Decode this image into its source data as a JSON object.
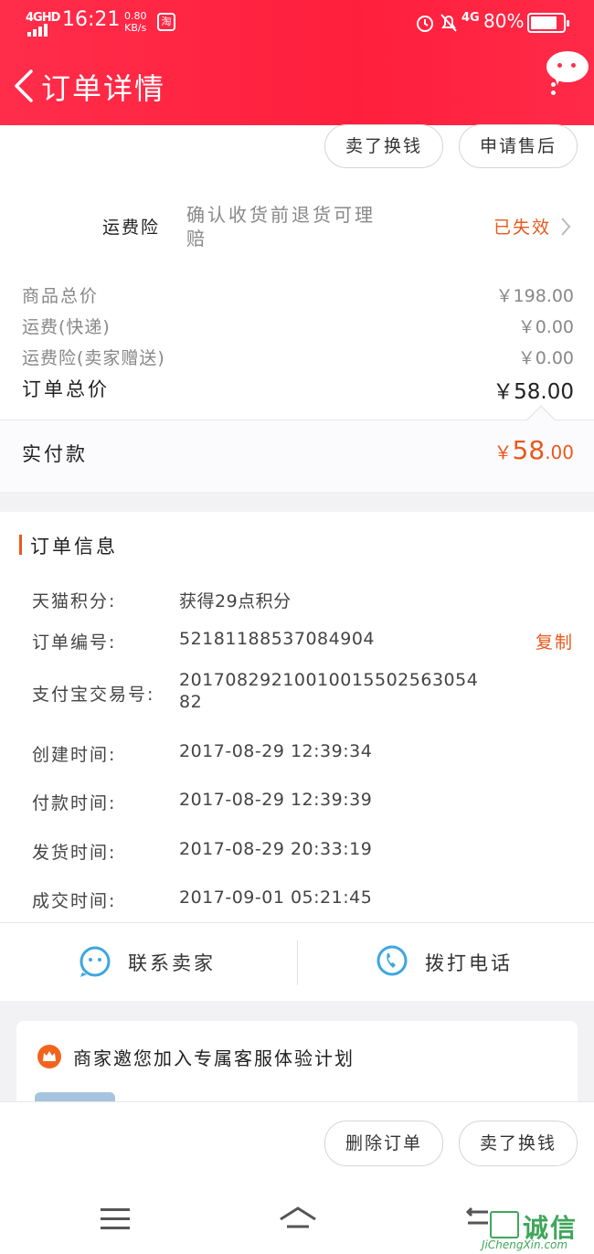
{
  "status_bar": {
    "network": "4GHD",
    "time": "16:21",
    "speed_value": "0.80",
    "speed_unit": "KB/s",
    "taobao_badge": "淘",
    "cellular": "4G",
    "battery": "80%"
  },
  "header": {
    "title": "订单详情"
  },
  "actions_top": {
    "sell_label": "卖了换钱",
    "aftersale_label": "申请售后"
  },
  "insurance": {
    "label": "运费险",
    "desc": "确认收货前退货可理赔",
    "status": "已失效"
  },
  "price": {
    "goods_total_label": "商品总价",
    "goods_total_value": "￥198.00",
    "shipping_label": "运费(快递)",
    "shipping_value": "￥0.00",
    "insurance_label": "运费险(卖家赠送)",
    "insurance_value": "￥0.00",
    "order_total_label": "订单总价",
    "order_total_value": "￥58.00",
    "paid_label": "实付款",
    "paid_currency": "￥",
    "paid_int": "58",
    "paid_dec": ".00"
  },
  "order_info": {
    "section_title": "订单信息",
    "points_label": "天猫积分:",
    "points_value": "获得29点积分",
    "order_no_label": "订单编号:",
    "order_no_value": "52181188537084904",
    "copy_label": "复制",
    "alipay_label": "支付宝交易号:",
    "alipay_value_line1": "201708292100100155025630​54",
    "alipay_value_line2": "82",
    "created_label": "创建时间:",
    "created_value": "2017-08-29 12:39:34",
    "paid_time_label": "付款时间:",
    "paid_time_value": "2017-08-29 12:39:39",
    "shipped_label": "发货时间:",
    "shipped_value": "2017-08-29 20:33:19",
    "deal_label": "成交时间:",
    "deal_value": "2017-09-01 05:21:45"
  },
  "contact": {
    "seller_label": "联系卖家",
    "call_label": "拨打电话"
  },
  "promo": {
    "title": "商家邀您加入专属客服体验计划"
  },
  "footer": {
    "delete_label": "删除订单",
    "sell_label": "卖了换钱"
  },
  "watermark": {
    "text": "诚信",
    "sub": "JiChengXin.com"
  },
  "colors": {
    "brand_red": "#ff2d4a",
    "accent_orange": "#e8591c"
  }
}
